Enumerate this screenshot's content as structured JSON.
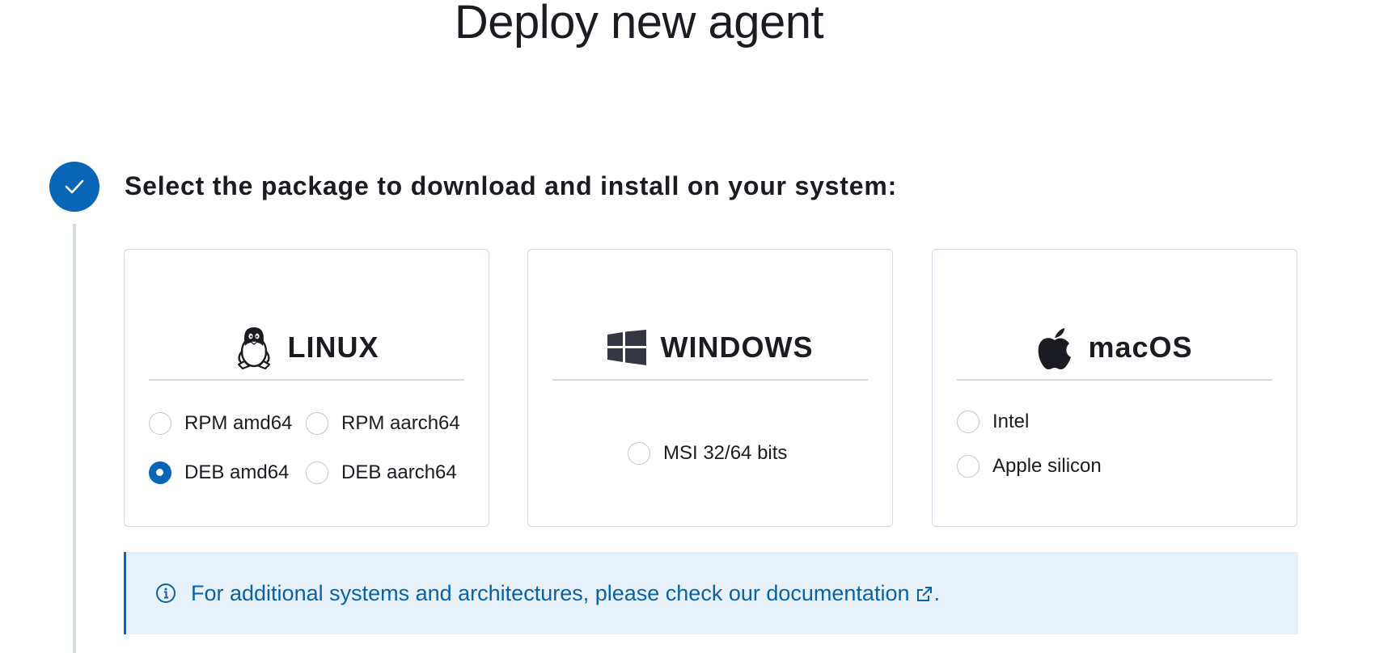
{
  "page": {
    "title": "Deploy new agent"
  },
  "step": {
    "status": "complete",
    "title": "Select the package to download and install on your system:"
  },
  "cards": [
    {
      "name": "LINUX",
      "icon": "linux-tux-icon",
      "options": [
        {
          "label": "RPM amd64",
          "selected": false
        },
        {
          "label": "RPM aarch64",
          "selected": false
        },
        {
          "label": "DEB amd64",
          "selected": true
        },
        {
          "label": "DEB aarch64",
          "selected": false
        }
      ]
    },
    {
      "name": "WINDOWS",
      "icon": "windows-logo-icon",
      "options": [
        {
          "label": "MSI 32/64 bits",
          "selected": false
        }
      ]
    },
    {
      "name": "macOS",
      "icon": "apple-logo-icon",
      "options": [
        {
          "label": "Intel",
          "selected": false
        },
        {
          "label": "Apple silicon",
          "selected": false
        }
      ]
    }
  ],
  "callout": {
    "text": "For additional systems and architectures, please check our ",
    "link_text": "documentation",
    "suffix": "."
  },
  "colors": {
    "primary": "#0965b5",
    "callout_bg": "#e6f1fa",
    "callout_text": "#0961a8",
    "border": "#d3dae6"
  }
}
